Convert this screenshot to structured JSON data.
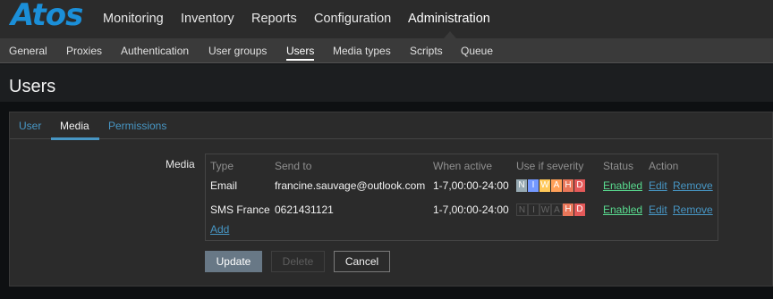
{
  "logo": "Atos",
  "top_nav": [
    "Monitoring",
    "Inventory",
    "Reports",
    "Configuration",
    "Administration"
  ],
  "sub_nav": [
    "General",
    "Proxies",
    "Authentication",
    "User groups",
    "Users",
    "Media types",
    "Scripts",
    "Queue"
  ],
  "page_title": "Users",
  "tabs": [
    "User",
    "Media",
    "Permissions"
  ],
  "media_label": "Media",
  "table": {
    "headers": [
      "Type",
      "Send to",
      "When active",
      "Use if severity",
      "Status",
      "Action"
    ],
    "rows": [
      {
        "type": "Email",
        "send_to": "francine.sauvage@outlook.com",
        "when_active": "1-7,00:00-24:00",
        "status": "Enabled",
        "edit": "Edit",
        "remove": "Remove"
      },
      {
        "type": "SMS France",
        "send_to": "0621431121",
        "when_active": "1-7,00:00-24:00",
        "status": "Enabled",
        "edit": "Edit",
        "remove": "Remove"
      }
    ],
    "add_label": "Add"
  },
  "severity_letters": [
    "N",
    "I",
    "W",
    "A",
    "H",
    "D"
  ],
  "severity_colors": [
    "#97aab3",
    "#7499ff",
    "#ffc859",
    "#ffa059",
    "#e97659",
    "#e45959"
  ],
  "severity_row1_enabled": [
    true,
    true,
    true,
    true,
    true,
    true
  ],
  "severity_row2_enabled": [
    false,
    false,
    false,
    false,
    true,
    true
  ],
  "buttons": {
    "update": "Update",
    "delete": "Delete",
    "cancel": "Cancel"
  }
}
